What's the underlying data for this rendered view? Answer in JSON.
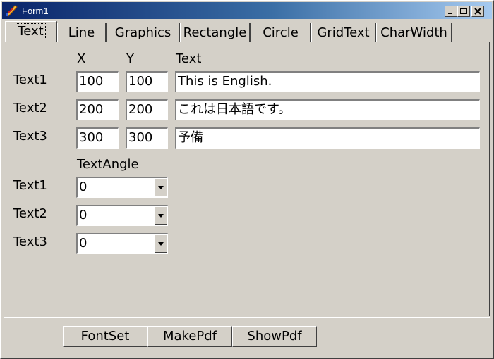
{
  "window": {
    "title": "Form1"
  },
  "tabs": [
    "Text",
    "Line",
    "Graphics",
    "Rectangle",
    "Circle",
    "GridText",
    "CharWidth"
  ],
  "columns": {
    "x": "X",
    "y": "Y",
    "text": "Text"
  },
  "rows": [
    {
      "label": "Text1",
      "x": "100",
      "y": "100",
      "text": "This is English."
    },
    {
      "label": "Text2",
      "x": "200",
      "y": "200",
      "text": "これは日本語です。"
    },
    {
      "label": "Text3",
      "x": "300",
      "y": "300",
      "text": "予備"
    }
  ],
  "angle_section": {
    "title": "TextAngle",
    "rows": [
      {
        "label": "Text1",
        "value": "0"
      },
      {
        "label": "Text2",
        "value": "0"
      },
      {
        "label": "Text3",
        "value": "0"
      }
    ]
  },
  "buttons": {
    "fontset": {
      "mnemonic": "F",
      "rest": "ontSet"
    },
    "makepdf": {
      "mnemonic": "M",
      "rest": "akePdf"
    },
    "showpdf": {
      "mnemonic": "S",
      "rest": "howPdf"
    }
  }
}
